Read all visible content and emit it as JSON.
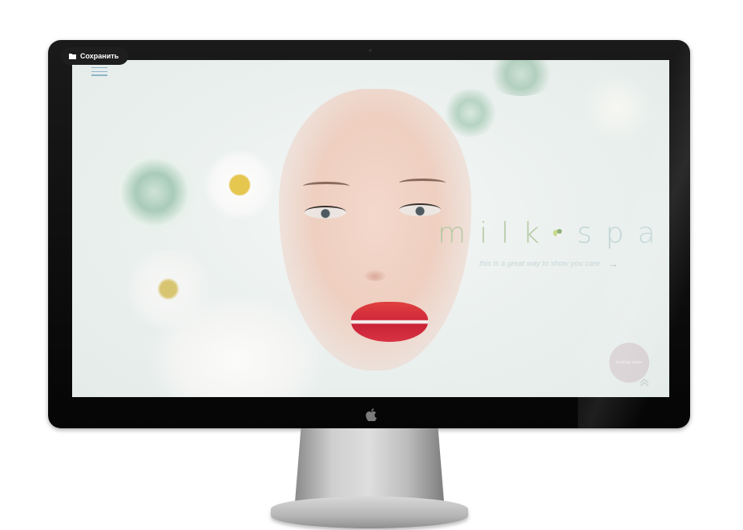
{
  "save_button": {
    "label": "Сохранить",
    "icon": "folder-icon"
  },
  "site": {
    "menu_icon": "hamburger-menu-icon",
    "brand": {
      "part1": "milk",
      "part2": "spa",
      "separator_icon": "flower-icon"
    },
    "tagline": "this is a great way to show you care",
    "tagline_arrow": "→",
    "circle_button": {
      "label": "booking online"
    },
    "scroll_icon": "chevron-up-icon"
  },
  "colors": {
    "screen_bg": "#eaf0ee",
    "accent_teal": "#8fb5c7",
    "brand_green": "#b6c9a4",
    "lips_red": "#d1283a",
    "button_pink": "#d9d2d5"
  }
}
